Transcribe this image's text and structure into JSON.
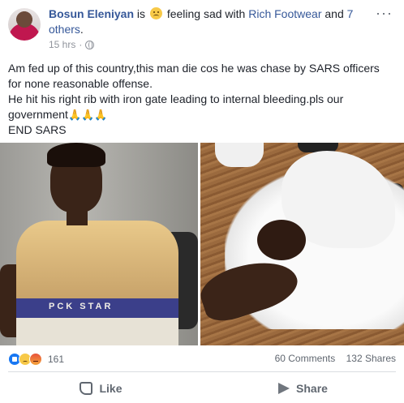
{
  "post": {
    "author": "Bosun Eleniyan",
    "is_text": "is",
    "feeling_text": "feeling sad with",
    "tagged_friend": "Rich Footwear",
    "and_text": "and",
    "others_link": "7 others",
    "period": ".",
    "time": "15 hrs",
    "dot": "·",
    "more": "···",
    "body_lines": [
      "Am fed up of this country,this man die cos he was chase by SARS officers for none reasonable offense.",
      "He hit his right rib with iron gate leading to internal bleeding.pls our government",
      "END SARS"
    ],
    "pray_emojis": "🙏🙏🙏"
  },
  "photos": {
    "left_shirt_text": "PCK STAR"
  },
  "stats": {
    "reaction_count": "161",
    "comments": "60 Comments",
    "shares": "132 Shares"
  },
  "actions": {
    "like_label": "Like",
    "share_label": "Share"
  }
}
